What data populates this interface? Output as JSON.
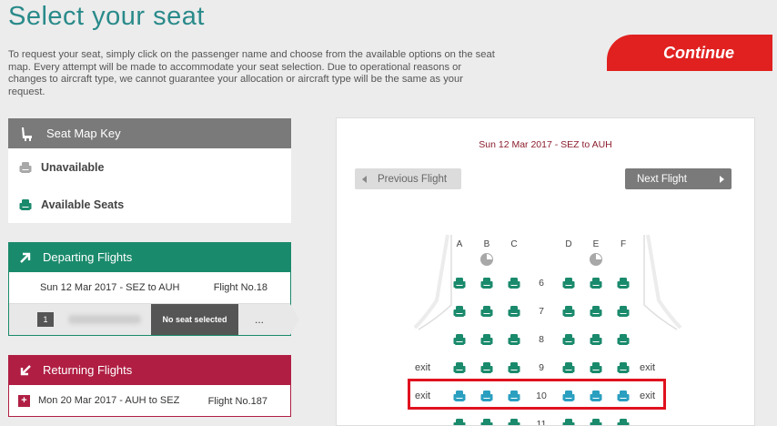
{
  "page": {
    "title": "Select your seat",
    "intro": "To request your seat, simply click on the passenger name and choose from the available options on the seat map. Every attempt will be made to accommodate your seat selection. Due to operational reasons or changes to aircraft type, we cannot guarantee your allocation or aircraft type will be the same as your request.",
    "continue_label": "Continue"
  },
  "key": {
    "title": "Seat Map Key",
    "items": [
      "Unavailable",
      "Available Seats"
    ]
  },
  "departing": {
    "title": "Departing Flights",
    "date_route": "Sun 12 Mar 2017 - SEZ to AUH",
    "flight_no": "Flight No.18",
    "passenger_number": "1",
    "seat_status": "No seat selected",
    "seat_value": "..."
  },
  "returning": {
    "title": "Returning Flights",
    "date_route": "Mon 20 Mar 2017 - AUH to SEZ",
    "flight_no": "Flight No.187"
  },
  "seatmap": {
    "header": "Sun 12 Mar 2017 - SEZ to AUH",
    "prev_label": "Previous Flight",
    "next_label": "Next Flight",
    "columns": [
      "A",
      "B",
      "C",
      "D",
      "E",
      "F"
    ],
    "exit_label": "exit",
    "rows": [
      {
        "num": "6",
        "seats": [
          "available",
          "unavailable",
          "available",
          "available",
          "unavailable",
          "available"
        ]
      },
      {
        "num": "7",
        "seats": [
          "available",
          "available",
          "available",
          "available",
          "available",
          "available"
        ]
      },
      {
        "num": "8",
        "seats": [
          "available",
          "available",
          "available",
          "available",
          "available",
          "available"
        ]
      },
      {
        "num": "9",
        "seats": [
          "available",
          "available",
          "available",
          "available",
          "available",
          "available"
        ],
        "exit": true
      },
      {
        "num": "10",
        "seats": [
          "extra",
          "extra",
          "extra",
          "extra",
          "extra",
          "extra"
        ],
        "exit": true,
        "highlighted": true
      },
      {
        "num": "11",
        "seats": [
          "available",
          "available",
          "available",
          "available",
          "available",
          "available"
        ]
      }
    ]
  },
  "colors": {
    "available": "#1a8a6c",
    "extra": "#2a9fc0",
    "unavailable": "#a8a8a8",
    "accent": "#e0211f",
    "departing": "#1a8a6c",
    "returning": "#b01e43"
  }
}
